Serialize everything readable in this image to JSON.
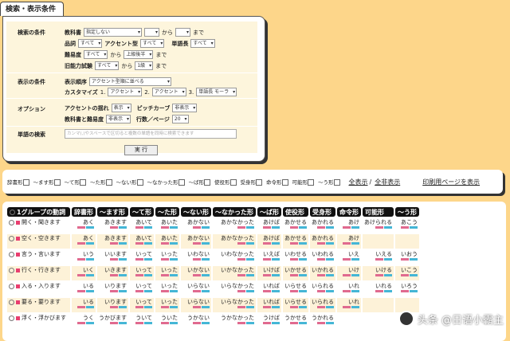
{
  "search_panel": {
    "tab_title": "検索・表示条件",
    "search_conditions": {
      "label": "検索の条件",
      "textbook_label": "教科書",
      "textbook_value": "指定しない",
      "from_value": "",
      "from_text": "から",
      "to_text": "まで",
      "pos_label": "品詞",
      "pos_value": "すべて",
      "accent_label": "アクセント型",
      "accent_value": "すべて",
      "word_len_label": "単語長",
      "word_len_value": "すべて",
      "difficulty_label": "難易度",
      "difficulty_from": "すべて",
      "difficulty_to": "上級後半",
      "old_test_label": "旧能力試験",
      "old_test_from": "すべて",
      "old_test_to": "1級"
    },
    "display_conditions": {
      "label": "表示の条件",
      "order_label": "表示順序",
      "order_value": "アクセント型順に並べる",
      "custom_label": "カスタマイズ",
      "c1_num": "1.",
      "c1_value": "アクセント",
      "c2_num": "2.",
      "c2_value": "アクセント",
      "c3_num": "3.",
      "c3_value": "単語長 モーラ"
    },
    "options": {
      "label": "オプション",
      "flow_label": "アクセントの揺れ",
      "flow_value": "表示",
      "pitch_label": "ピッチカーブ",
      "pitch_value": "非表示",
      "tb_diff_label": "教科書と難易度",
      "tb_diff_value": "非表示",
      "rows_label": "行数／ページ",
      "rows_value": "20"
    },
    "word_search": {
      "label": "単語の検索",
      "placeholder": "カンマ(,)やスペースで区切ると複数の単語を同時に検索できます"
    },
    "execute_button": "実 行"
  },
  "filter_bar": {
    "forms": [
      "辞書形",
      "～ます形",
      "～て形",
      "～た形",
      "～ない形",
      "～なかった形",
      "～ば形",
      "使役形",
      "受身形",
      "命令形",
      "可能形",
      "～う形"
    ],
    "show_all": "全表示",
    "separator": "/",
    "hide_all": "全非表示",
    "print_page": "印刷用ページを表示"
  },
  "table": {
    "headers": [
      "1グループの動詞",
      "辞書形",
      "～ます形",
      "～て形",
      "～た形",
      "～ない形",
      "～なかった形",
      "～ば形",
      "使役形",
      "受身形",
      "命令形",
      "可能形",
      "～う形"
    ],
    "rows": [
      {
        "name": "開く・聞きます",
        "cells": [
          "あく",
          "あきます",
          "あいて",
          "あいた",
          "あかない",
          "あかなかった",
          "あけば",
          "あかせる",
          "あかれる",
          "あけ",
          "あけられる",
          "あこう"
        ]
      },
      {
        "name": "空く・空きます",
        "cells": [
          "あく",
          "あきます",
          "あいて",
          "あいた",
          "あかない",
          "あかなかった",
          "あけば",
          "あかせる",
          "あかれる",
          "あけ",
          "",
          ""
        ]
      },
      {
        "name": "言う・言います",
        "cells": [
          "いう",
          "いいます",
          "いって",
          "いった",
          "いわない",
          "いわなかった",
          "いえば",
          "いわせる",
          "いわれる",
          "いえ",
          "いえる",
          "いおう"
        ]
      },
      {
        "name": "行く・行きます",
        "cells": [
          "いく",
          "いきます",
          "いって",
          "いった",
          "いかない",
          "いかなかった",
          "いけば",
          "いかせる",
          "いかれる",
          "いけ",
          "いける",
          "いこう"
        ]
      },
      {
        "name": "入る・入ります",
        "cells": [
          "いる",
          "いります",
          "いって",
          "いった",
          "いらない",
          "いらなかった",
          "いれば",
          "いらせる",
          "いられる",
          "いれ",
          "いれる",
          "いろう"
        ]
      },
      {
        "name": "要る・要ります",
        "cells": [
          "いる",
          "いります",
          "いって",
          "いった",
          "いらない",
          "いらなかった",
          "いれば",
          "いらせる",
          "いられる",
          "いれ",
          "",
          ""
        ]
      },
      {
        "name": "浮く・浮かびます",
        "cells": [
          "うく",
          "うかびます",
          "ういて",
          "ういた",
          "うかない",
          "うかなかった",
          "うけば",
          "うかせる",
          "うかれる",
          "",
          "",
          ""
        ]
      }
    ]
  },
  "watermark": "头条 @日语小霸主"
}
